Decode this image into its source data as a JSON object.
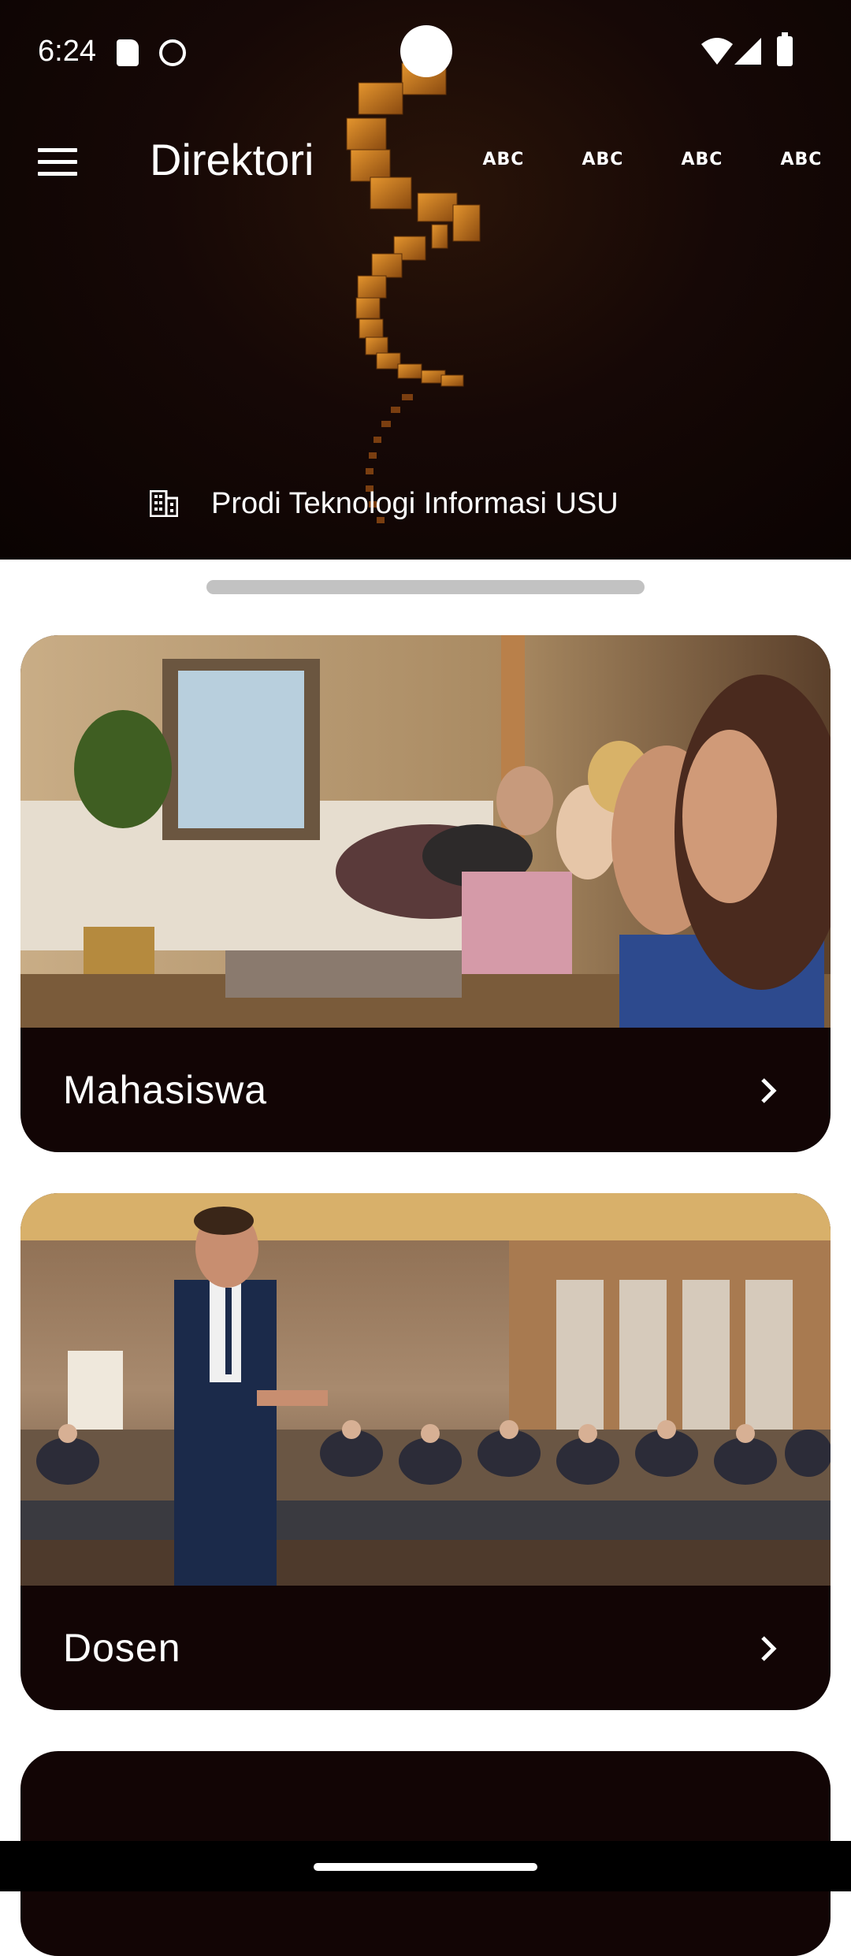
{
  "status_bar": {
    "time": "6:24",
    "icons": [
      "sd-card-icon",
      "cat-face-icon",
      "wifi-icon",
      "cell-signal-icon",
      "battery-icon"
    ]
  },
  "app_bar": {
    "title": "Direktori",
    "menu_icon": "menu-icon",
    "tabs": [
      "ABC",
      "ABC",
      "ABC",
      "ABC"
    ]
  },
  "header": {
    "subtitle": "Prodi Teknologi Informasi USU",
    "subtitle_icon": "building-icon",
    "accent_color": "#c77a1e",
    "background_color": "#150706"
  },
  "cards": [
    {
      "label": "Mahasiswa",
      "image": "students-in-seminar-photo"
    },
    {
      "label": "Dosen",
      "image": "lecturer-presenting-photo"
    },
    {
      "label": "",
      "image": ""
    }
  ],
  "colors": {
    "card_background": "#120505",
    "drag_handle": "#c2c2c2"
  }
}
